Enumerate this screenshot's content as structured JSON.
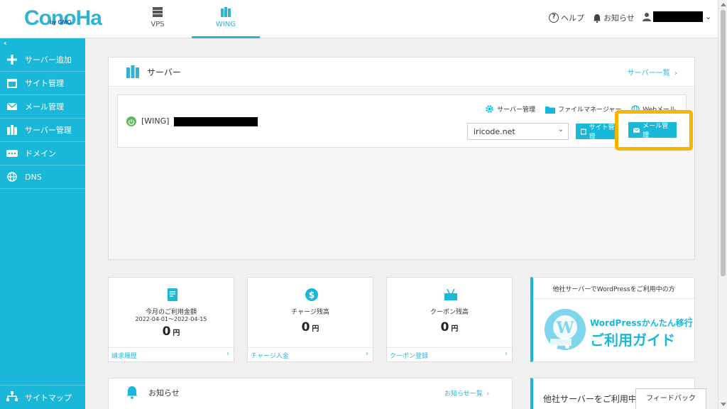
{
  "header": {
    "logo": "ConoHa",
    "logo_sub": "by GMO",
    "nav": [
      {
        "label": "VPS"
      },
      {
        "label": "WING"
      }
    ],
    "help": "ヘルプ",
    "notifications": "お知らせ"
  },
  "sidebar": {
    "collapse": "‹",
    "items": [
      {
        "label": "サーバー追加",
        "icon": "plus-icon"
      },
      {
        "label": "サイト管理",
        "icon": "window-icon"
      },
      {
        "label": "メール管理",
        "icon": "mail-icon"
      },
      {
        "label": "サーバー管理",
        "icon": "server-icon"
      },
      {
        "label": "ドメイン",
        "icon": "domain-icon"
      },
      {
        "label": "DNS",
        "icon": "globe-icon"
      }
    ],
    "sitemap": "サイトマップ"
  },
  "server_panel": {
    "title": "サーバー",
    "list_link": "サーバー一覧",
    "server_name": "[WING]",
    "links": {
      "server_manage": "サーバー管理",
      "file_manager": "ファイルマネージャー",
      "web_mail": "Webメール"
    },
    "domain_value": "iricode.net",
    "site_manage_btn": "サイト管理",
    "mail_manage_btn": "メール管理"
  },
  "stats": [
    {
      "title": "今月のご利用金額",
      "sub": "2022-04-01～2022-04-15",
      "value": "0",
      "unit": "円",
      "link": "請求履歴"
    },
    {
      "title": "チャージ残高",
      "value": "0",
      "unit": "円",
      "link": "チャージ入金"
    },
    {
      "title": "クーポン残高",
      "value": "0",
      "unit": "円",
      "link": "クーポン登録"
    }
  ],
  "wp_banner": {
    "top": "他社サーバーでWordPressをご利用中の方",
    "line1": "WordPressかんたん移行",
    "line2": "ご利用ガイド"
  },
  "notice": {
    "title": "お知らせ",
    "link": "お知らせ一覧"
  },
  "other_panel": {
    "text": "他社サーバーをご利用中の方"
  },
  "feedback": "フィードバック",
  "colors": {
    "accent": "#1ab8d8",
    "highlight": "#f7b500",
    "power": "#5cb85c"
  }
}
